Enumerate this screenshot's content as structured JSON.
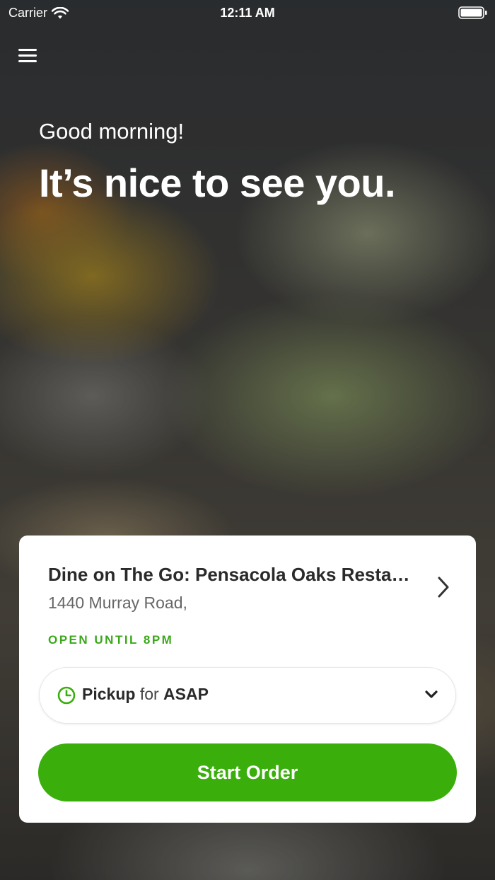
{
  "status_bar": {
    "carrier": "Carrier",
    "time": "12:11 AM"
  },
  "hero": {
    "greeting": "Good morning!",
    "headline": "It’s nice to see you."
  },
  "store": {
    "name": "Dine on The Go: Pensacola Oaks Restaurant",
    "address": "1440 Murray Road,",
    "open_status": "OPEN UNTIL 8PM"
  },
  "order_mode": {
    "mode": "Pickup",
    "connector": "for",
    "time": "ASAP"
  },
  "actions": {
    "start_order": "Start Order"
  },
  "colors": {
    "accent": "#3aaf0c",
    "open_text": "#3aa81a"
  }
}
